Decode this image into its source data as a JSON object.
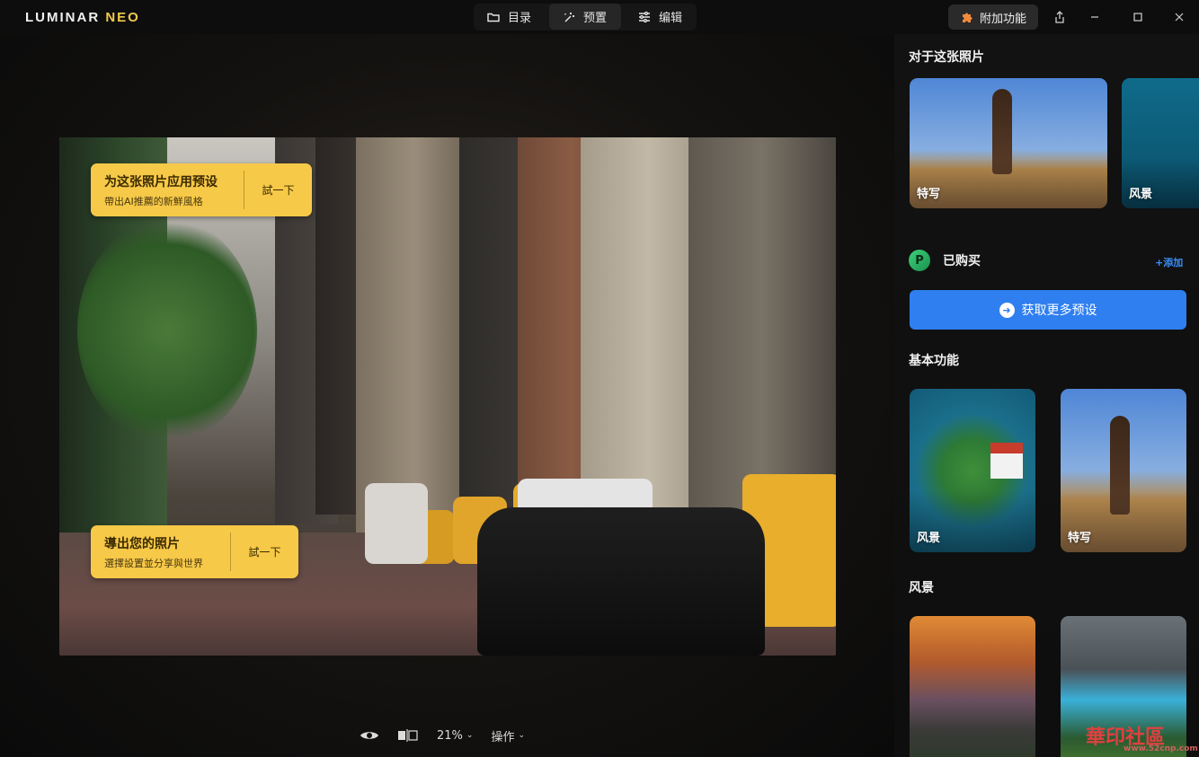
{
  "app": {
    "logo_main": "LUMINAR",
    "logo_accent": "NEO"
  },
  "nav": {
    "tabs": [
      {
        "label": "目录",
        "icon": "folder-icon",
        "active": false
      },
      {
        "label": "预置",
        "icon": "magic-wand-icon",
        "active": true
      },
      {
        "label": "编辑",
        "icon": "sliders-icon",
        "active": false
      }
    ]
  },
  "toolbar": {
    "addon_label": "附加功能"
  },
  "tips": {
    "presets": {
      "title": "为这张照片应用预设",
      "subtitle": "帶出AI推薦的新鮮風格",
      "try_label": "試一下"
    },
    "export": {
      "title": "導出您的照片",
      "subtitle": "選擇設置並分享與世界",
      "try_label": "試一下"
    }
  },
  "bottom_bar": {
    "zoom": "21%",
    "actions": "操作"
  },
  "panel": {
    "section_this_photo": "对于这张照片",
    "this_photo_cards": [
      {
        "label": "特写"
      },
      {
        "label": "风景"
      }
    ],
    "purchased_label": "已购买",
    "add_link": "+添加",
    "get_more_label": "获取更多预设",
    "section_basic": "基本功能",
    "basic_cards": [
      {
        "label": "风景"
      },
      {
        "label": "特写"
      }
    ],
    "section_landscape": "风景"
  },
  "watermark": {
    "text": "華印社區",
    "url": "www.52cnp.com"
  },
  "colors": {
    "accent_blue": "#2f7ff0",
    "tip_yellow": "#f7c948",
    "logo_accent": "#f2c94c"
  }
}
